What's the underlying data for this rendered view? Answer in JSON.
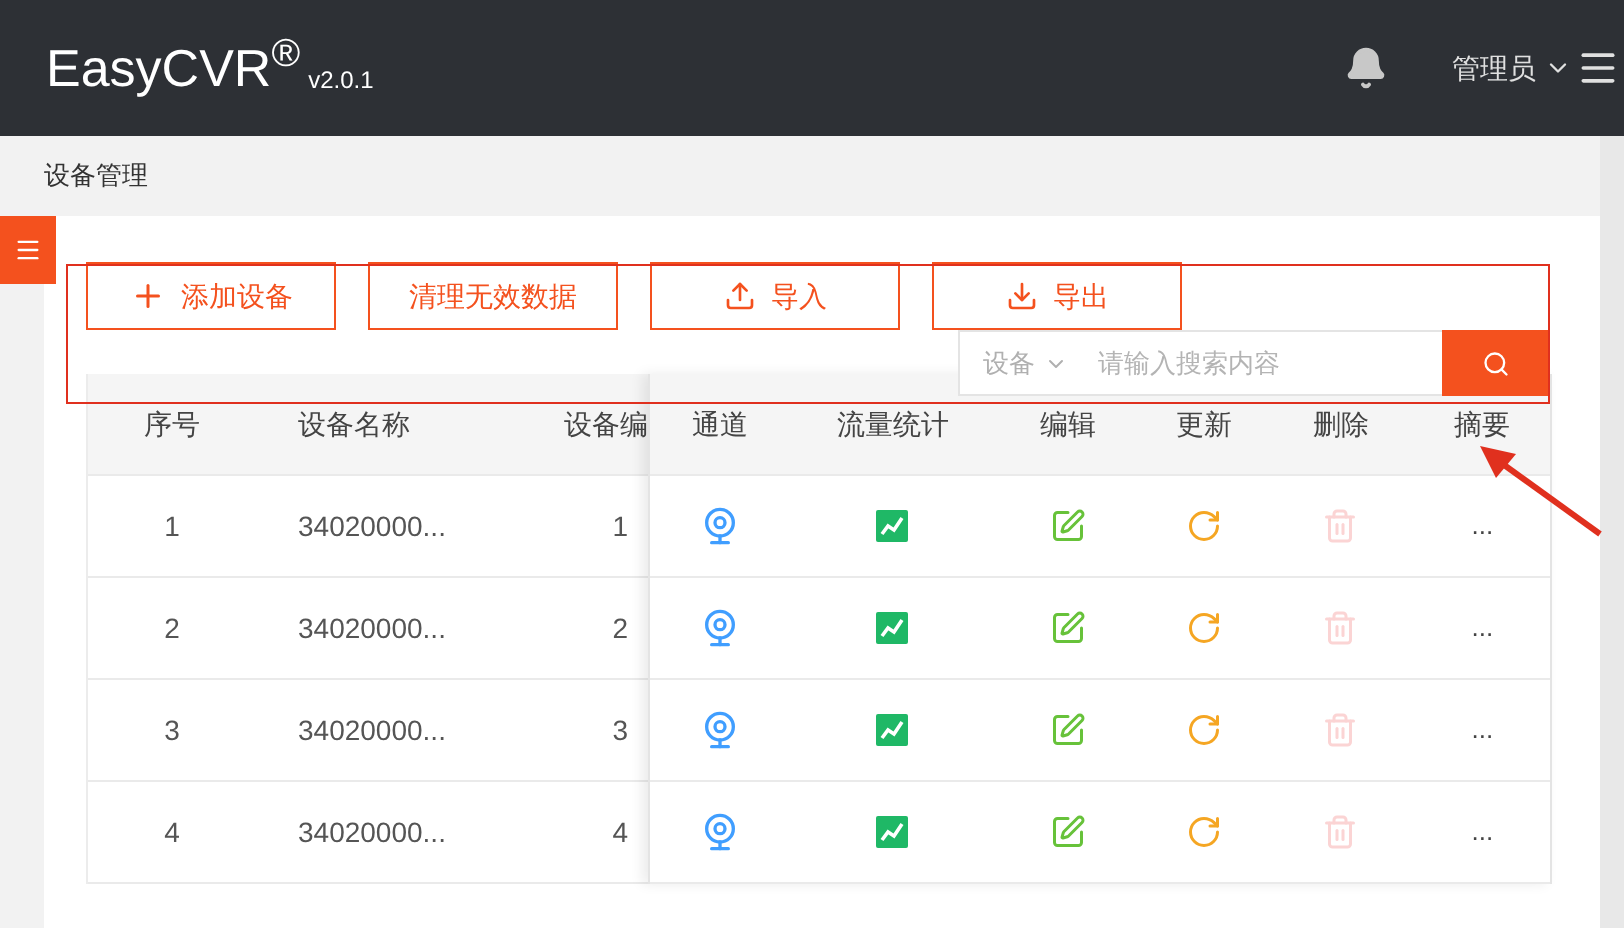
{
  "header": {
    "logo": "EasyCVR$^{®}$",
    "version": "v2.0.1",
    "user": "管理员"
  },
  "breadcrumb": "设备管理",
  "toolbar": {
    "buttons": [
      {
        "kind": "add",
        "label": "添加设备"
      },
      {
        "kind": "plain",
        "label": "清理无效数据"
      },
      {
        "kind": "upload",
        "label": "导入"
      },
      {
        "kind": "download",
        "label": "导出"
      }
    ]
  },
  "search": {
    "scope": "设备",
    "placeholder": "请输入搜索内容"
  },
  "table": {
    "columns": [
      "序号",
      "设备名称",
      "设备编"
    ],
    "action_columns": [
      "通道",
      "流量统计",
      "编辑",
      "更新",
      "删除",
      "摘要"
    ],
    "rows": [
      {
        "index": "1",
        "name": "34020000...",
        "code": "1",
        "summary": "...",
        "delete_disabled": true
      },
      {
        "index": "2",
        "name": "34020000...",
        "code": "2",
        "summary": "...",
        "delete_disabled": true
      },
      {
        "index": "3",
        "name": "34020000...",
        "code": "3",
        "summary": "...",
        "delete_disabled": true
      },
      {
        "index": "4",
        "name": "34020000...",
        "code": "4",
        "summary": "...",
        "delete_disabled": true
      }
    ]
  }
}
